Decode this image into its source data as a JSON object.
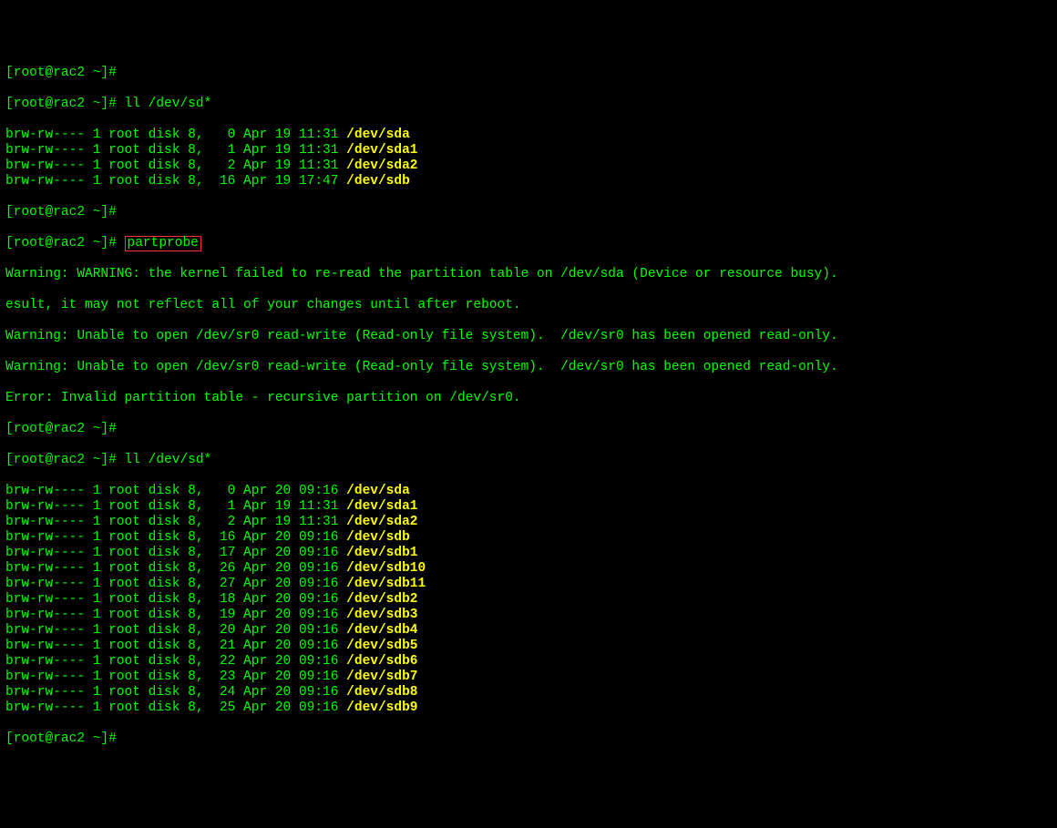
{
  "prompt1": "[root@rac2 ~]#",
  "prompt2": "[root@rac2 ~]# ",
  "cmd_ll": "ll /dev/sd*",
  "cmd_partprobe": "partprobe",
  "ls1": [
    {
      "perm": "brw-rw---- 1 root disk 8,   0 Apr 19 11:31 ",
      "dev": "/dev/sda"
    },
    {
      "perm": "brw-rw---- 1 root disk 8,   1 Apr 19 11:31 ",
      "dev": "/dev/sda1"
    },
    {
      "perm": "brw-rw---- 1 root disk 8,   2 Apr 19 11:31 ",
      "dev": "/dev/sda2"
    },
    {
      "perm": "brw-rw---- 1 root disk 8,  16 Apr 19 17:47 ",
      "dev": "/dev/sdb"
    }
  ],
  "warn1": "Warning: WARNING: the kernel failed to re-read the partition table on /dev/sda (Device or resource busy).  ",
  "warn1b": "esult, it may not reflect all of your changes until after reboot.",
  "warn2": "Warning: Unable to open /dev/sr0 read-write (Read-only file system).  /dev/sr0 has been opened read-only.",
  "warn3": "Warning: Unable to open /dev/sr0 read-write (Read-only file system).  /dev/sr0 has been opened read-only.",
  "err1": "Error: Invalid partition table - recursive partition on /dev/sr0.",
  "ls2": [
    {
      "perm": "brw-rw---- 1 root disk 8,   0 Apr 20 09:16 ",
      "dev": "/dev/sda"
    },
    {
      "perm": "brw-rw---- 1 root disk 8,   1 Apr 19 11:31 ",
      "dev": "/dev/sda1"
    },
    {
      "perm": "brw-rw---- 1 root disk 8,   2 Apr 19 11:31 ",
      "dev": "/dev/sda2"
    },
    {
      "perm": "brw-rw---- 1 root disk 8,  16 Apr 20 09:16 ",
      "dev": "/dev/sdb"
    },
    {
      "perm": "brw-rw---- 1 root disk 8,  17 Apr 20 09:16 ",
      "dev": "/dev/sdb1"
    },
    {
      "perm": "brw-rw---- 1 root disk 8,  26 Apr 20 09:16 ",
      "dev": "/dev/sdb10"
    },
    {
      "perm": "brw-rw---- 1 root disk 8,  27 Apr 20 09:16 ",
      "dev": "/dev/sdb11"
    },
    {
      "perm": "brw-rw---- 1 root disk 8,  18 Apr 20 09:16 ",
      "dev": "/dev/sdb2"
    },
    {
      "perm": "brw-rw---- 1 root disk 8,  19 Apr 20 09:16 ",
      "dev": "/dev/sdb3"
    },
    {
      "perm": "brw-rw---- 1 root disk 8,  20 Apr 20 09:16 ",
      "dev": "/dev/sdb4"
    },
    {
      "perm": "brw-rw---- 1 root disk 8,  21 Apr 20 09:16 ",
      "dev": "/dev/sdb5"
    },
    {
      "perm": "brw-rw---- 1 root disk 8,  22 Apr 20 09:16 ",
      "dev": "/dev/sdb6"
    },
    {
      "perm": "brw-rw---- 1 root disk 8,  23 Apr 20 09:16 ",
      "dev": "/dev/sdb7"
    },
    {
      "perm": "brw-rw---- 1 root disk 8,  24 Apr 20 09:16 ",
      "dev": "/dev/sdb8"
    },
    {
      "perm": "brw-rw---- 1 root disk 8,  25 Apr 20 09:16 ",
      "dev": "/dev/sdb9"
    }
  ]
}
